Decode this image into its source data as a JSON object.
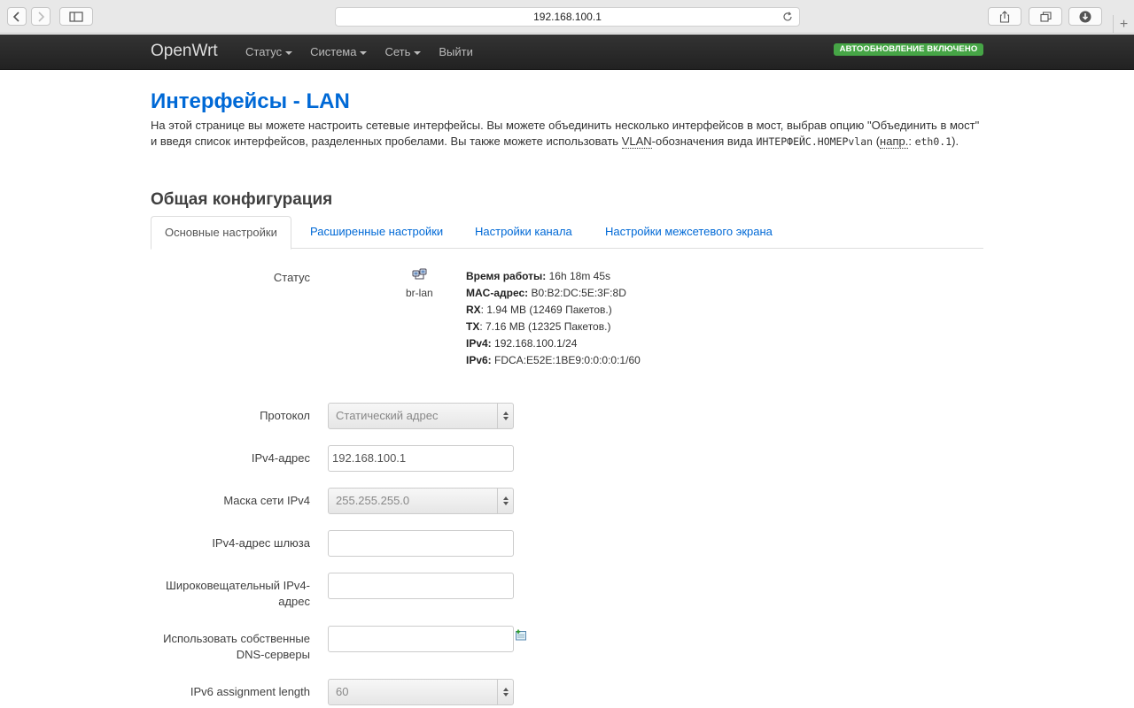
{
  "browser": {
    "url": "192.168.100.1"
  },
  "navbar": {
    "brand": "OpenWrt",
    "menu": [
      {
        "label": "Статус",
        "has_dropdown": true
      },
      {
        "label": "Система",
        "has_dropdown": true
      },
      {
        "label": "Сеть",
        "has_dropdown": true
      },
      {
        "label": "Выйти",
        "has_dropdown": false
      }
    ],
    "auto_refresh_badge": "АВТООБНОВЛЕНИЕ ВКЛЮЧЕНО",
    "badge_color": "#46a546"
  },
  "page": {
    "title": "Интерфейсы - LAN",
    "desc_part1": "На этой странице вы можете настроить сетевые интерфейсы. Вы можете объединить несколько интерфейсов в мост, выбрав опцию \"Объединить в мост\" и введя список интерфейсов, разделенных пробелами. Вы также можете использовать ",
    "desc_vlan_abbr": "VLAN",
    "desc_part2": "-обозначения вида ",
    "desc_code1": "ИНТЕРФЕЙС.НОМЕРvlan",
    "desc_part3": " (",
    "desc_example_abbr": "напр.",
    "desc_part4": ": ",
    "desc_code2": "eth0.1",
    "desc_part5": ").",
    "section_title": "Общая конфигурация",
    "accent_color": "#0069d6"
  },
  "tabs": [
    {
      "label": "Основные настройки",
      "active": true
    },
    {
      "label": "Расширенные настройки",
      "active": false
    },
    {
      "label": "Настройки канала",
      "active": false
    },
    {
      "label": "Настройки межсетевого экрана",
      "active": false
    }
  ],
  "status": {
    "label": "Статус",
    "interface_name": "br-lan",
    "interface_icon": "network-bridge-icon",
    "uptime_label": "Время работы:",
    "uptime_value": " 16h 18m 45s",
    "mac_label": "MAC-адрес:",
    "mac_value": " B0:B2:DC:5E:3F:8D",
    "rx_label": "RX",
    "rx_value": ": 1.94 MB (12469 Пакетов.)",
    "tx_label": "TX",
    "tx_value": ": 7.16 MB (12325 Пакетов.)",
    "ipv4_label": "IPv4:",
    "ipv4_value": " 192.168.100.1/24",
    "ipv6_label": "IPv6:",
    "ipv6_value": " FDCA:E52E:1BE9:0:0:0:0:1/60"
  },
  "form": {
    "protocol": {
      "label": "Протокол",
      "value": "Статический адрес"
    },
    "ipv4_address": {
      "label": "IPv4-адрес",
      "value": "192.168.100.1"
    },
    "ipv4_netmask": {
      "label": "Маска сети IPv4",
      "value": "255.255.255.0"
    },
    "ipv4_gateway": {
      "label": "IPv4-адрес шлюза",
      "value": ""
    },
    "ipv4_broadcast": {
      "label": "Широковещательный IPv4-адрес",
      "value": ""
    },
    "custom_dns": {
      "label": "Использовать собственные DNS-серверы",
      "value": "",
      "add_icon": "add-entry-icon"
    },
    "ipv6_assignment_length": {
      "label": "IPv6 assignment length",
      "value": "60"
    }
  }
}
